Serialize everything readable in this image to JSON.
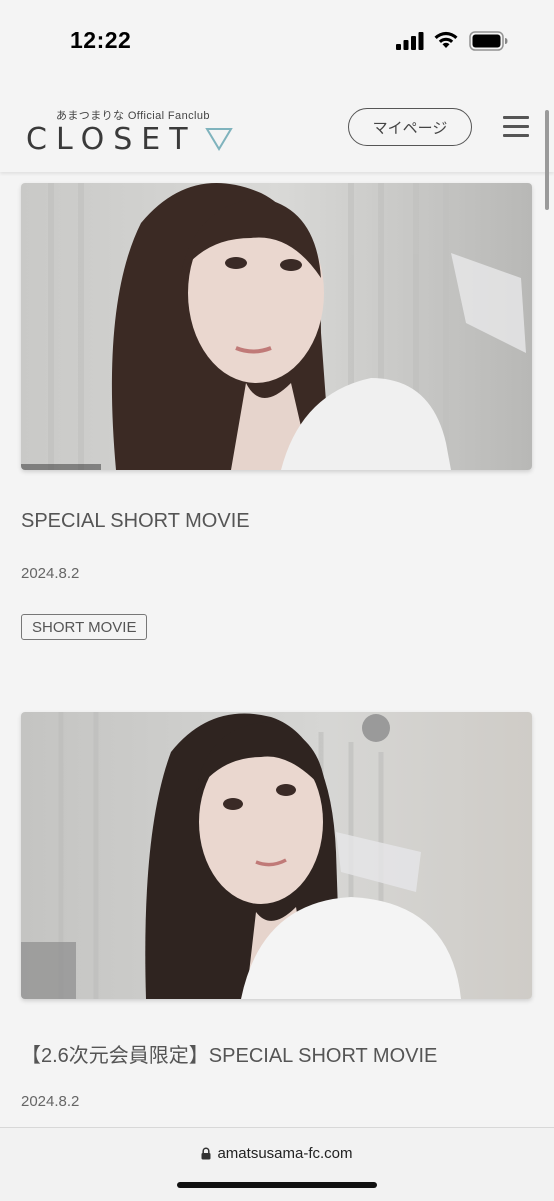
{
  "status_bar": {
    "time": "12:22"
  },
  "header": {
    "logo_subtitle": "あまつまりな Official Fanclub",
    "logo_title": "CLOSET",
    "mypage_label": "マイページ"
  },
  "posts": [
    {
      "title": "SPECIAL SHORT MOVIE",
      "date": "2024.8.2",
      "tag": "SHORT MOVIE"
    },
    {
      "title": "【2.6次元会員限定】SPECIAL SHORT MOVIE",
      "date": "2024.8.2"
    }
  ],
  "browser": {
    "url": "amatsusama-fc.com"
  },
  "colors": {
    "background": "#f4f4f4",
    "accent_triangle": "#7fb3bd",
    "text": "#555555"
  }
}
